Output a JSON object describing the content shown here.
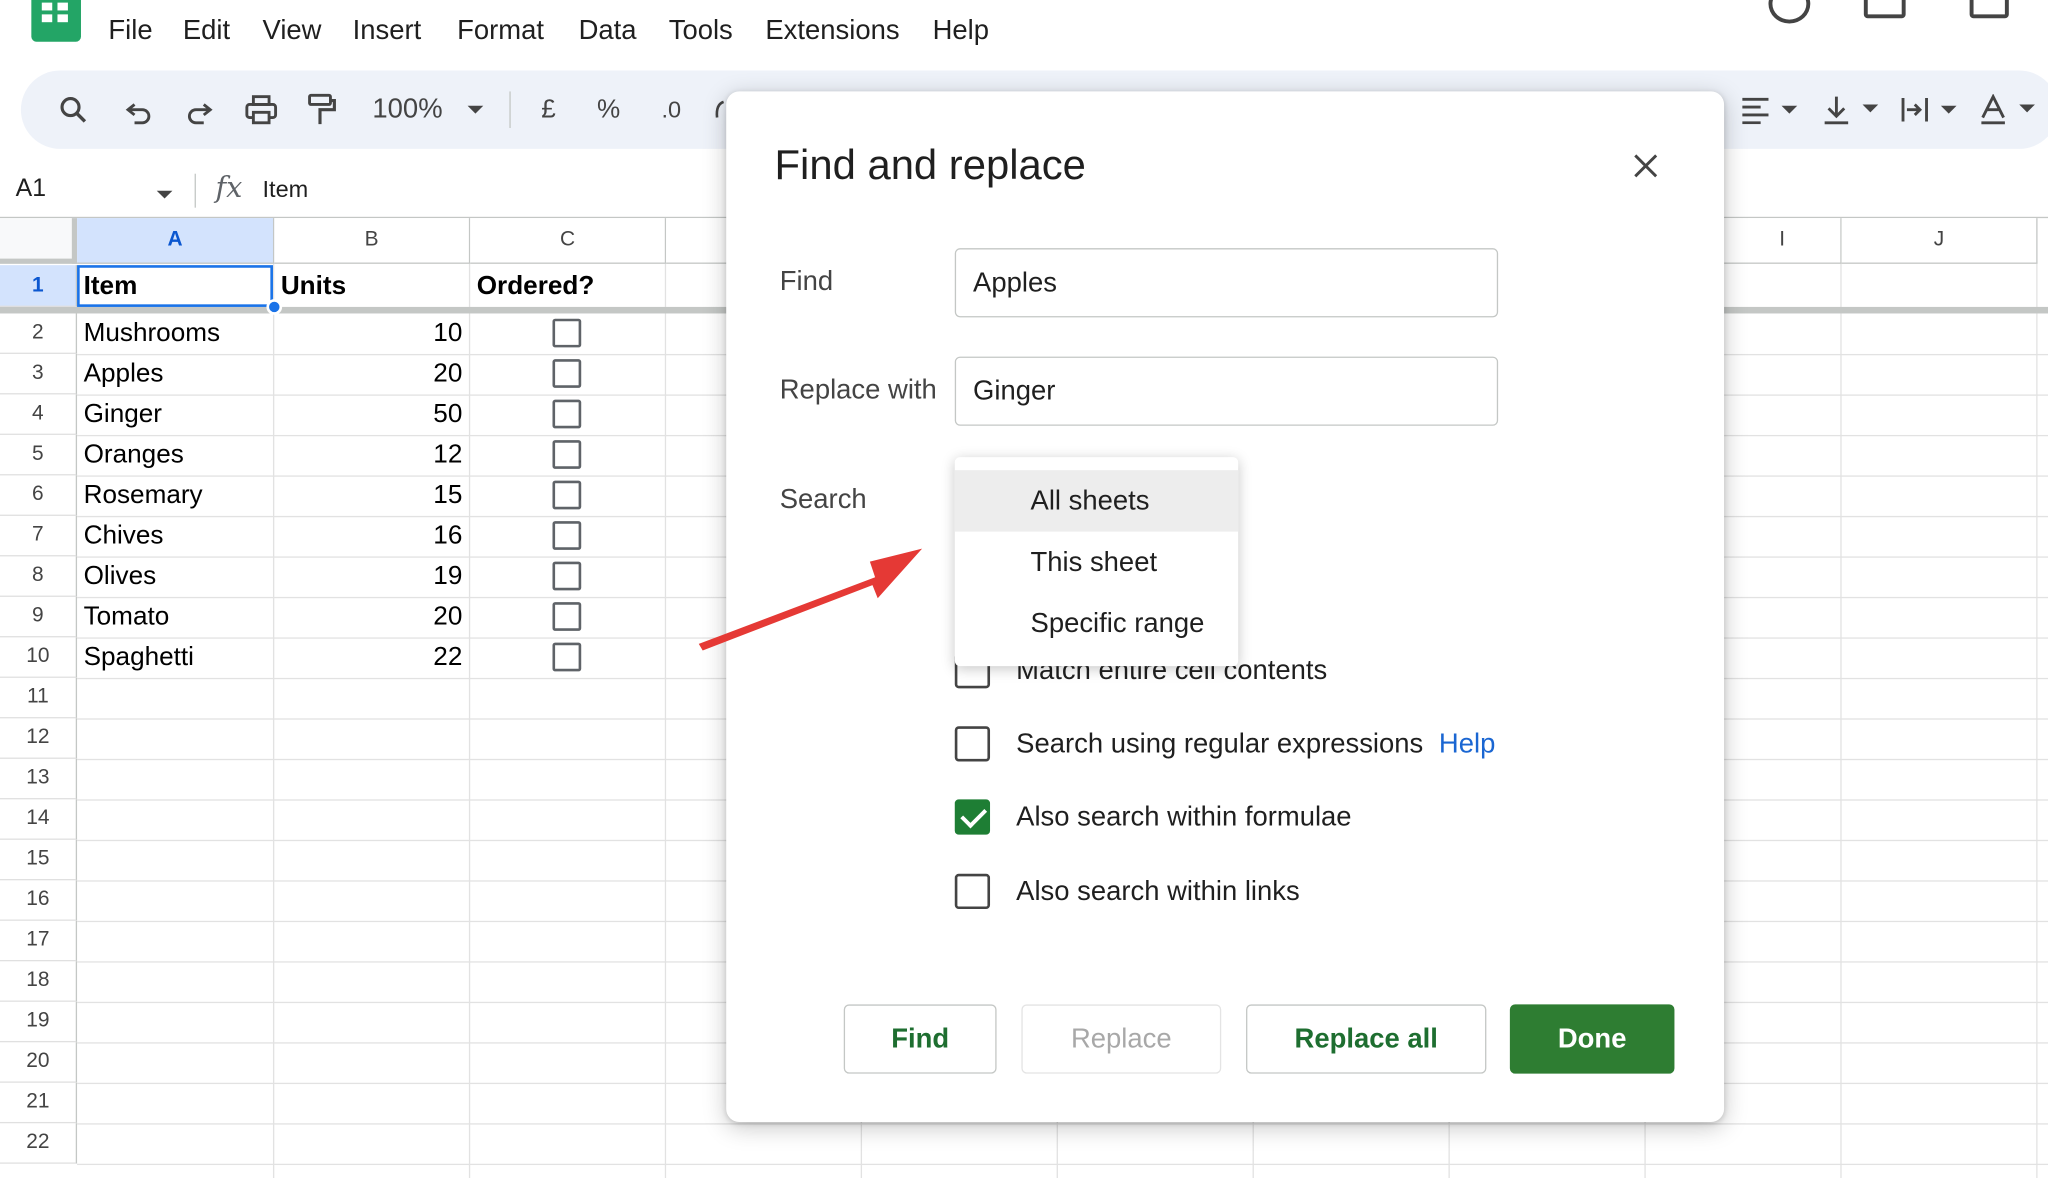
{
  "menubar": {
    "items": [
      "File",
      "Edit",
      "View",
      "Insert",
      "Format",
      "Data",
      "Tools",
      "Extensions",
      "Help"
    ]
  },
  "toolbar": {
    "zoom": "100%",
    "currency": "£",
    "percent": "%",
    "decimal": ".0"
  },
  "formula_bar": {
    "cell_ref": "A1",
    "fx": "fx",
    "value": "Item"
  },
  "grid": {
    "columns": [
      "A",
      "B",
      "C",
      "I",
      "J"
    ],
    "rows": [
      "1",
      "2",
      "3",
      "4",
      "5",
      "6",
      "7",
      "8",
      "9",
      "10",
      "11",
      "12",
      "13",
      "14",
      "15",
      "16",
      "17",
      "18",
      "19",
      "20",
      "21",
      "22"
    ],
    "header_row": [
      "Item",
      "Units",
      "Ordered?"
    ],
    "data": [
      {
        "item": "Mushrooms",
        "units": "10"
      },
      {
        "item": "Apples",
        "units": "20"
      },
      {
        "item": "Ginger",
        "units": "50"
      },
      {
        "item": "Oranges",
        "units": "12"
      },
      {
        "item": "Rosemary",
        "units": "15"
      },
      {
        "item": "Chives",
        "units": "16"
      },
      {
        "item": "Olives",
        "units": "19"
      },
      {
        "item": "Tomato",
        "units": "20"
      },
      {
        "item": "Spaghetti",
        "units": "22"
      }
    ]
  },
  "dialog": {
    "title": "Find and replace",
    "find_label": "Find",
    "find_value": "Apples",
    "replace_label": "Replace with",
    "replace_value": "Ginger",
    "search_label": "Search",
    "search_options": [
      "All sheets",
      "This sheet",
      "Specific range"
    ],
    "selected_search": "All sheets",
    "options": [
      {
        "label": "Match entire cell contents",
        "checked": false
      },
      {
        "label": "Search using regular expressions",
        "checked": false,
        "help": "Help"
      },
      {
        "label": "Also search within formulae",
        "checked": true
      },
      {
        "label": "Also search within links",
        "checked": false
      }
    ],
    "buttons": {
      "find": "Find",
      "replace": "Replace",
      "replace_all": "Replace all",
      "done": "Done"
    }
  },
  "colors": {
    "accent_green": "#2e7d32",
    "link_blue": "#1a66d2",
    "arrow_red": "#e53935",
    "selection_blue": "#1a73e8"
  }
}
